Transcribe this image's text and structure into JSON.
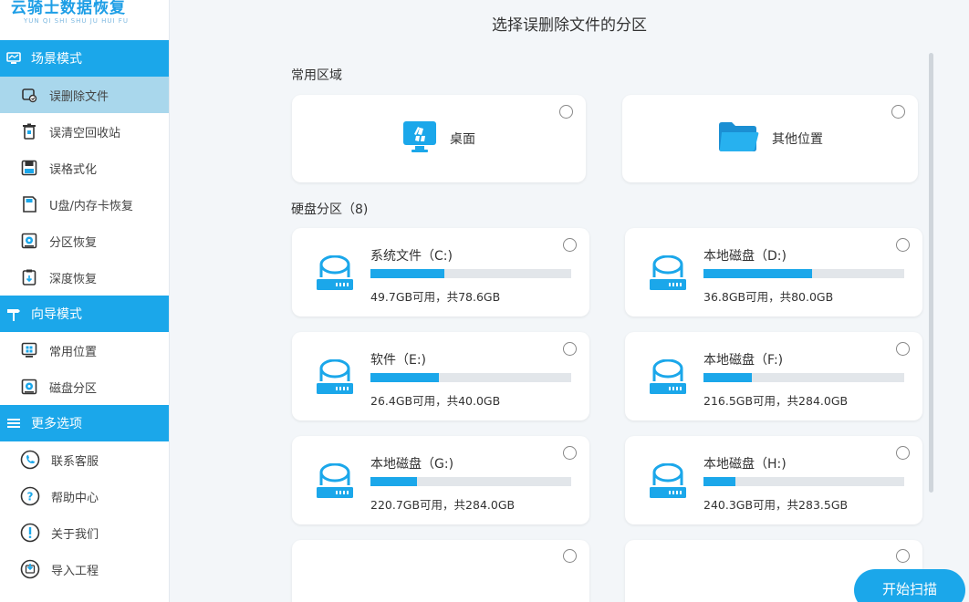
{
  "brand": {
    "title": "云骑士数据恢复",
    "subtitle": "YUN QI SHI SHU JU HUI FU"
  },
  "sidebar": {
    "sections": [
      {
        "header": "场景模式",
        "items": [
          {
            "label": "误删除文件",
            "icon": "file-recover-icon",
            "active": true
          },
          {
            "label": "误清空回收站",
            "icon": "recycle-bin-icon"
          },
          {
            "label": "误格式化",
            "icon": "floppy-disk-icon"
          },
          {
            "label": "U盘/内存卡恢复",
            "icon": "sd-card-icon"
          },
          {
            "label": "分区恢复",
            "icon": "partition-icon"
          },
          {
            "label": "深度恢复",
            "icon": "deep-recover-icon"
          }
        ]
      },
      {
        "header": "向导模式",
        "items": [
          {
            "label": "常用位置",
            "icon": "windows-icon"
          },
          {
            "label": "磁盘分区",
            "icon": "disk-partition-icon"
          }
        ]
      },
      {
        "header": "更多选项",
        "items": [
          {
            "label": "联系客服",
            "icon": "headset-icon"
          },
          {
            "label": "帮助中心",
            "icon": "question-icon"
          },
          {
            "label": "关于我们",
            "icon": "info-icon"
          },
          {
            "label": "导入工程",
            "icon": "import-icon"
          }
        ]
      }
    ]
  },
  "main": {
    "title": "选择误删除文件的分区",
    "common_label": "常用区域",
    "common": [
      {
        "label": "桌面",
        "icon": "desktop-icon"
      },
      {
        "label": "其他位置",
        "icon": "folder-icon"
      }
    ],
    "disk_label": "硬盘分区（8)",
    "disks": [
      {
        "name": "系统文件（C:)",
        "info": "49.7GB可用，共78.6GB",
        "used": 0.37
      },
      {
        "name": "本地磁盘（D:)",
        "info": "36.8GB可用，共80.0GB",
        "used": 0.54
      },
      {
        "name": "软件（E:)",
        "info": "26.4GB可用，共40.0GB",
        "used": 0.34
      },
      {
        "name": "本地磁盘（F:)",
        "info": "216.5GB可用，共284.0GB",
        "used": 0.24
      },
      {
        "name": "本地磁盘（G:)",
        "info": "220.7GB可用，共284.0GB",
        "used": 0.23
      },
      {
        "name": "本地磁盘（H:)",
        "info": "240.3GB可用，共283.5GB",
        "used": 0.16
      }
    ],
    "scan_button": "开始扫描"
  }
}
